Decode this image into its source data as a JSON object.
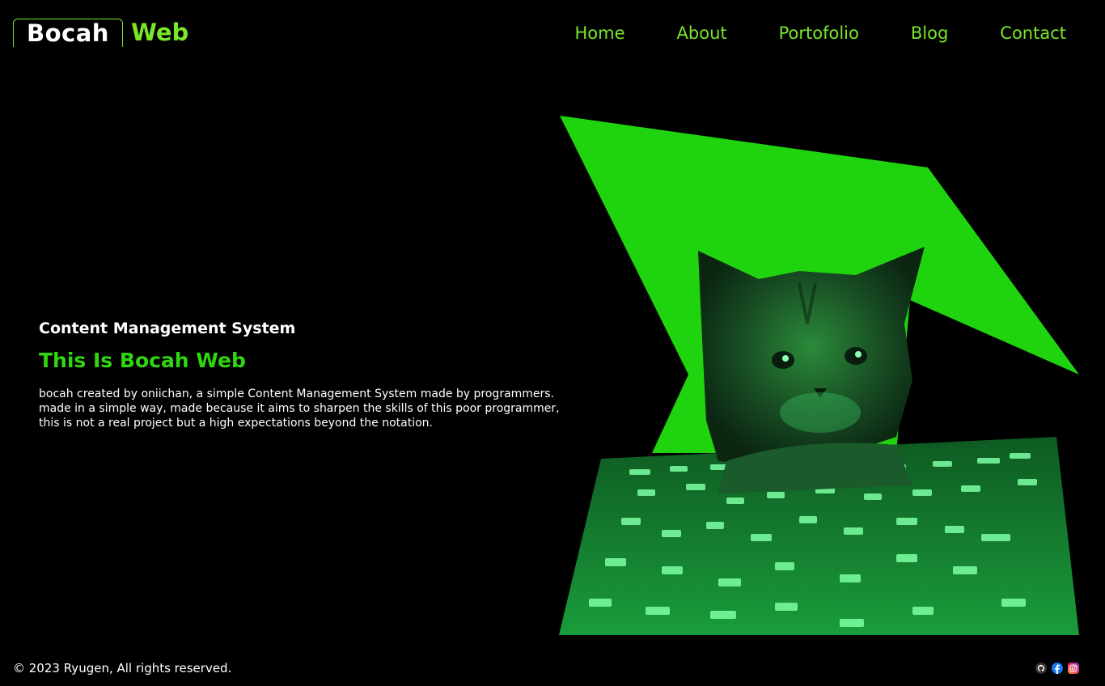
{
  "header": {
    "logo_primary": "Bocah",
    "logo_secondary": "Web",
    "nav": [
      {
        "label": "Home"
      },
      {
        "label": "About"
      },
      {
        "label": "Portofolio"
      },
      {
        "label": "Blog"
      },
      {
        "label": "Contact"
      }
    ]
  },
  "hero": {
    "subtitle": "Content Management System",
    "title": "This Is Bocah Web",
    "description": "bocah created by oniichan, a simple Content Management System made by programmers. made in a simple way, made because it aims to sharpen the skills of this poor programmer, this is not a real project but a high expectations beyond the notation."
  },
  "footer": {
    "copyright": "© 2023 Ryugen, All rights reserved.",
    "socials": [
      "github-icon",
      "facebook-icon",
      "instagram-icon"
    ]
  },
  "colors": {
    "background": "#000000",
    "accent": "#7ae628",
    "hero_green": "#1fd40e",
    "text": "#ffffff"
  }
}
